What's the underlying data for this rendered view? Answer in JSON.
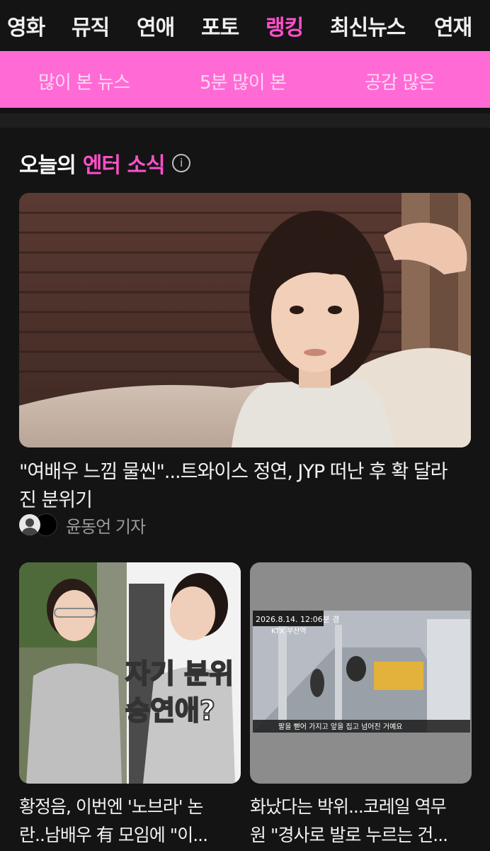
{
  "top_nav": {
    "tabs": [
      {
        "label": "영화"
      },
      {
        "label": "뮤직"
      },
      {
        "label": "연애"
      },
      {
        "label": "포토"
      },
      {
        "label": "랭킹"
      },
      {
        "label": "최신뉴스"
      },
      {
        "label": "연재"
      }
    ],
    "active": "랭킹"
  },
  "sub_nav": {
    "items": [
      {
        "label": "많이 본 뉴스"
      },
      {
        "label": "5분 많이 본"
      },
      {
        "label": "공감 많은"
      }
    ]
  },
  "section": {
    "title_prefix": "오늘의",
    "title_accent": "엔터 소식"
  },
  "hero": {
    "title_line1": "\"여배우 느낌 물씬\"...트와이스 정연, JYP 떠난 후 확 달라",
    "title_line2": "진 분위기",
    "author": "윤동언 기자"
  },
  "cards": [
    {
      "title_line1": "황정음, 이번엔 '노브라' 논",
      "title_line2": "란..남배우 有 모임에 \"이...",
      "overlay_line1": "자기 분위",
      "overlay_line2": "승연애?"
    },
    {
      "title_line1": "화났다는 박위...코레일 역무",
      "title_line2": "원 \"경사로 발로 누르는 건...",
      "cctv_caption": "팔을 뻗어 가지고 앞을 집고 넘어진 거예요",
      "cctv_timestamp": "2026.8.14. 12:06분 경",
      "cctv_station": "KTX 부산역"
    }
  ],
  "colors": {
    "background": "#141414",
    "accent": "#ff4fcb",
    "subnav_bg": "#ff6ad5"
  }
}
